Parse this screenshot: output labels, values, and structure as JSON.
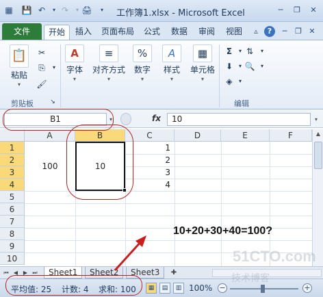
{
  "window": {
    "title": "工作簿1.xlsx - Microsoft Excel"
  },
  "tabs": [
    {
      "label": "文件"
    },
    {
      "label": "开始"
    },
    {
      "label": "插入"
    },
    {
      "label": "页面布局"
    },
    {
      "label": "公式"
    },
    {
      "label": "数据"
    },
    {
      "label": "审阅"
    },
    {
      "label": "视图"
    }
  ],
  "ribbon": {
    "paste_label": "粘贴",
    "clipboard_group": "剪贴板",
    "font_label": "字体",
    "align_label": "对齐方式",
    "number_label": "数字",
    "style_label": "样式",
    "cells_label": "单元格",
    "editing_group": "编辑"
  },
  "formula_bar": {
    "name_box": "B1",
    "fx": "fx",
    "value": "10"
  },
  "grid": {
    "columns": [
      "A",
      "B",
      "C",
      "D",
      "E",
      "F"
    ],
    "rows": [
      "1",
      "2",
      "3",
      "4",
      "5",
      "6",
      "7",
      "8",
      "9",
      "10"
    ],
    "cells": {
      "A_merged": "100",
      "B_merged": "10",
      "C1": "1",
      "C2": "2",
      "C3": "3",
      "C4": "4"
    }
  },
  "sheets": [
    "Sheet1",
    "Sheet2",
    "Sheet3"
  ],
  "status": {
    "average": "平均值: 25",
    "count": "计数: 4",
    "sum": "求和: 100",
    "zoom": "100%"
  },
  "annotation": {
    "text": "10+20+30+40=100?"
  },
  "watermark": {
    "line1": "51CTO.com",
    "line2": "技术博客"
  },
  "colors": {
    "file_tab": "#2d7c3a",
    "selection_header": "#f9d97a",
    "annotation": "#b22222"
  }
}
